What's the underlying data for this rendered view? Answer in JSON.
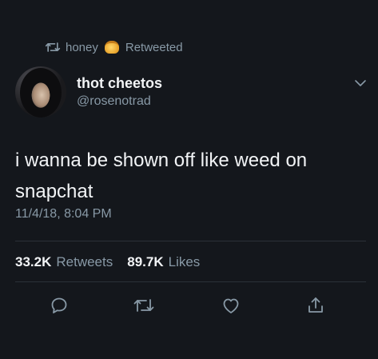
{
  "retweet": {
    "user": "honey",
    "label": "Retweeted",
    "icon": "retweet-icon",
    "emoji": "honey-pot-emoji"
  },
  "author": {
    "display_name": "thot cheetos",
    "handle": "@rosenotrad"
  },
  "tweet": {
    "text_line1": "i wanna be shown off like weed on",
    "text_line2": "snapchat",
    "timestamp": "11/4/18, 8:04 PM"
  },
  "stats": {
    "retweets_count": "33.2K",
    "retweets_label": "Retweets",
    "likes_count": "89.7K",
    "likes_label": "Likes"
  },
  "actions": [
    {
      "icon": "reply-icon"
    },
    {
      "icon": "retweet-icon"
    },
    {
      "icon": "like-icon"
    },
    {
      "icon": "share-icon"
    }
  ],
  "colors": {
    "background": "#14171c",
    "primary_text": "#f2f4f6",
    "secondary_text": "#8899a6",
    "divider": "#2b3138"
  }
}
